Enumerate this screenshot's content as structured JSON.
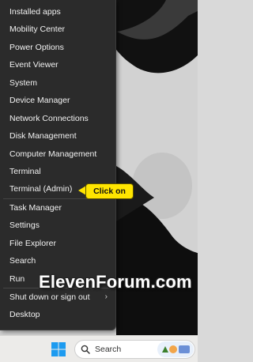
{
  "menu": {
    "items": [
      {
        "label": "Installed apps"
      },
      {
        "label": "Mobility Center"
      },
      {
        "label": "Power Options"
      },
      {
        "label": "Event Viewer"
      },
      {
        "label": "System"
      },
      {
        "label": "Device Manager"
      },
      {
        "label": "Network Connections"
      },
      {
        "label": "Disk Management"
      },
      {
        "label": "Computer Management"
      },
      {
        "label": "Terminal"
      },
      {
        "label": "Terminal (Admin)"
      },
      {
        "label": "Task Manager"
      },
      {
        "label": "Settings"
      },
      {
        "label": "File Explorer"
      },
      {
        "label": "Search"
      },
      {
        "label": "Run"
      },
      {
        "label": "Shut down or sign out",
        "submenu_icon": "chevron-right-icon"
      },
      {
        "label": "Desktop"
      }
    ]
  },
  "callout": {
    "label": "Click on",
    "color": "#ffe500"
  },
  "watermark": {
    "text": "ElevenForum.com"
  },
  "taskbar": {
    "start_icon": "windows-logo-icon",
    "search": {
      "placeholder": "Search",
      "icon": "search-icon"
    }
  },
  "colors": {
    "menu_bg": "#2b2b2b",
    "menu_text": "#f2f2f2",
    "taskbar_bg": "#ecebe9",
    "windows_blue": "#1d9bf0"
  }
}
